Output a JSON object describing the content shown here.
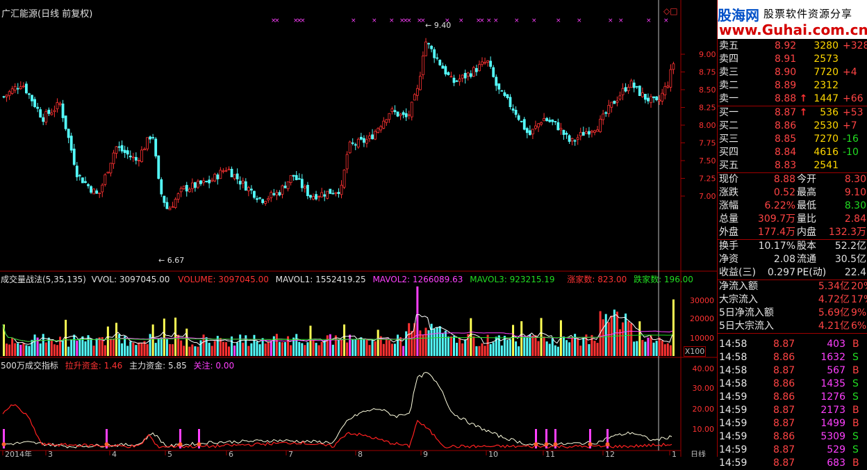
{
  "stock": {
    "title": "广汇能源(日线 前复权)",
    "price_high_label": "9.40",
    "price_low_label": "6.67"
  },
  "price_axis": {
    "ticks": [
      "9.00",
      "8.75",
      "8.50",
      "8.25",
      "8.00",
      "7.75",
      "7.50",
      "7.25",
      "7.00"
    ]
  },
  "volume_panel": {
    "name": "成交量战法(5,35,135)",
    "vvol": "VVOL: 3097045.00",
    "volume": "VOLUME: 3097045.00",
    "mavol1": "MAVOL1: 1552419.25",
    "mavol2": "MAVOL2: 1266089.63",
    "mavol3": "MAVOL3: 923215.19",
    "up_count": "涨家数: 823.00",
    "down_count": "跌家数: 196.00",
    "axis": [
      "30000",
      "20000",
      "10000"
    ],
    "unit": "X100"
  },
  "fund_panel": {
    "name": "500万成交指标",
    "rise_fund": "拉升资金: 1.46",
    "main_fund": "主力资金: 5.85",
    "focus": "关注: 0.00",
    "axis": [
      "40.00",
      "30.00",
      "20.00",
      "10.00"
    ]
  },
  "x_axis": {
    "labels": [
      "2014年",
      "3",
      "4",
      "5",
      "6",
      "7",
      "8",
      "9",
      "10",
      "11",
      "12",
      "1"
    ],
    "period": "日线"
  },
  "logo": {
    "name": "股海网",
    "slogan": "股票软件资源分享",
    "url": "www.Guhai.com.cn"
  },
  "order_book": {
    "asks": [
      {
        "label": "卖五",
        "price": "8.92",
        "vol": "3280",
        "chg": "+328"
      },
      {
        "label": "卖四",
        "price": "8.91",
        "vol": "2573",
        "chg": ""
      },
      {
        "label": "卖三",
        "price": "8.90",
        "vol": "7720",
        "chg": "+4"
      },
      {
        "label": "卖二",
        "price": "8.89",
        "vol": "2312",
        "chg": ""
      },
      {
        "label": "卖一",
        "price": "8.88",
        "vol": "1447",
        "chg": "+66",
        "arrow": "↑"
      }
    ],
    "bids": [
      {
        "label": "买一",
        "price": "8.87",
        "vol": "536",
        "chg": "+53",
        "arrow": "↑"
      },
      {
        "label": "买二",
        "price": "8.86",
        "vol": "2530",
        "chg": "+7"
      },
      {
        "label": "买三",
        "price": "8.85",
        "vol": "7270",
        "chg": "-16"
      },
      {
        "label": "买四",
        "price": "8.84",
        "vol": "4616",
        "chg": "-10"
      },
      {
        "label": "买五",
        "price": "8.83",
        "vol": "2541",
        "chg": ""
      }
    ]
  },
  "stats": [
    {
      "l1": "现价",
      "v1": "8.88",
      "l2": "今开",
      "v2": "8.30"
    },
    {
      "l1": "涨跌",
      "v1": "0.52",
      "l2": "最高",
      "v2": "9.10"
    },
    {
      "l1": "涨幅",
      "v1": "6.22%",
      "l2": "最低",
      "v2": "8.30"
    },
    {
      "l1": "总量",
      "v1": "309.7万",
      "l2": "量比",
      "v2": "2.84"
    },
    {
      "l1": "外盘",
      "v1": "177.4万",
      "l2": "内盘",
      "v2": "132.3万"
    }
  ],
  "stats2": [
    {
      "l1": "换手",
      "v1": "10.17%",
      "l2": "股本",
      "v2": "52.2亿"
    },
    {
      "l1": "净资",
      "v1": "2.08",
      "l2": "流通",
      "v2": "30.5亿"
    },
    {
      "l1": "收益(三)",
      "v1": "0.297",
      "l2": "PE(动)",
      "v2": "22.4"
    }
  ],
  "flows": [
    {
      "label": "净流入额",
      "value": "5.34亿",
      "pct": "20%"
    },
    {
      "label": "大宗流入",
      "value": "4.72亿",
      "pct": "17%"
    },
    {
      "label": "5日净流入额",
      "value": "5.69亿",
      "pct": "9%"
    },
    {
      "label": "5日大宗流入",
      "value": "4.21亿",
      "pct": "6%"
    }
  ],
  "ticks": [
    {
      "time": "14:58",
      "price": "8.87",
      "vol": "403",
      "side": "B"
    },
    {
      "time": "14:58",
      "price": "8.86",
      "vol": "1632",
      "side": "S"
    },
    {
      "time": "14:58",
      "price": "8.87",
      "vol": "567",
      "side": "B"
    },
    {
      "time": "14:58",
      "price": "8.86",
      "vol": "1435",
      "side": "S"
    },
    {
      "time": "14:59",
      "price": "8.86",
      "vol": "1276",
      "side": "S"
    },
    {
      "time": "14:59",
      "price": "8.87",
      "vol": "2173",
      "side": "B"
    },
    {
      "time": "14:59",
      "price": "8.87",
      "vol": "1499",
      "side": "B"
    },
    {
      "time": "14:59",
      "price": "8.86",
      "vol": "5309",
      "side": "S"
    },
    {
      "time": "14:59",
      "price": "8.87",
      "vol": "529",
      "side": "S"
    },
    {
      "time": "14:59",
      "price": "8.87",
      "vol": "683",
      "side": "B"
    }
  ],
  "colors": {
    "up": "#ff3232",
    "down": "#54fcfc",
    "grid": "#a00000",
    "ma1": "#ffffff",
    "ma2": "#ff40ff",
    "ma3": "#22dd22",
    "highlight": "#ffff54"
  }
}
